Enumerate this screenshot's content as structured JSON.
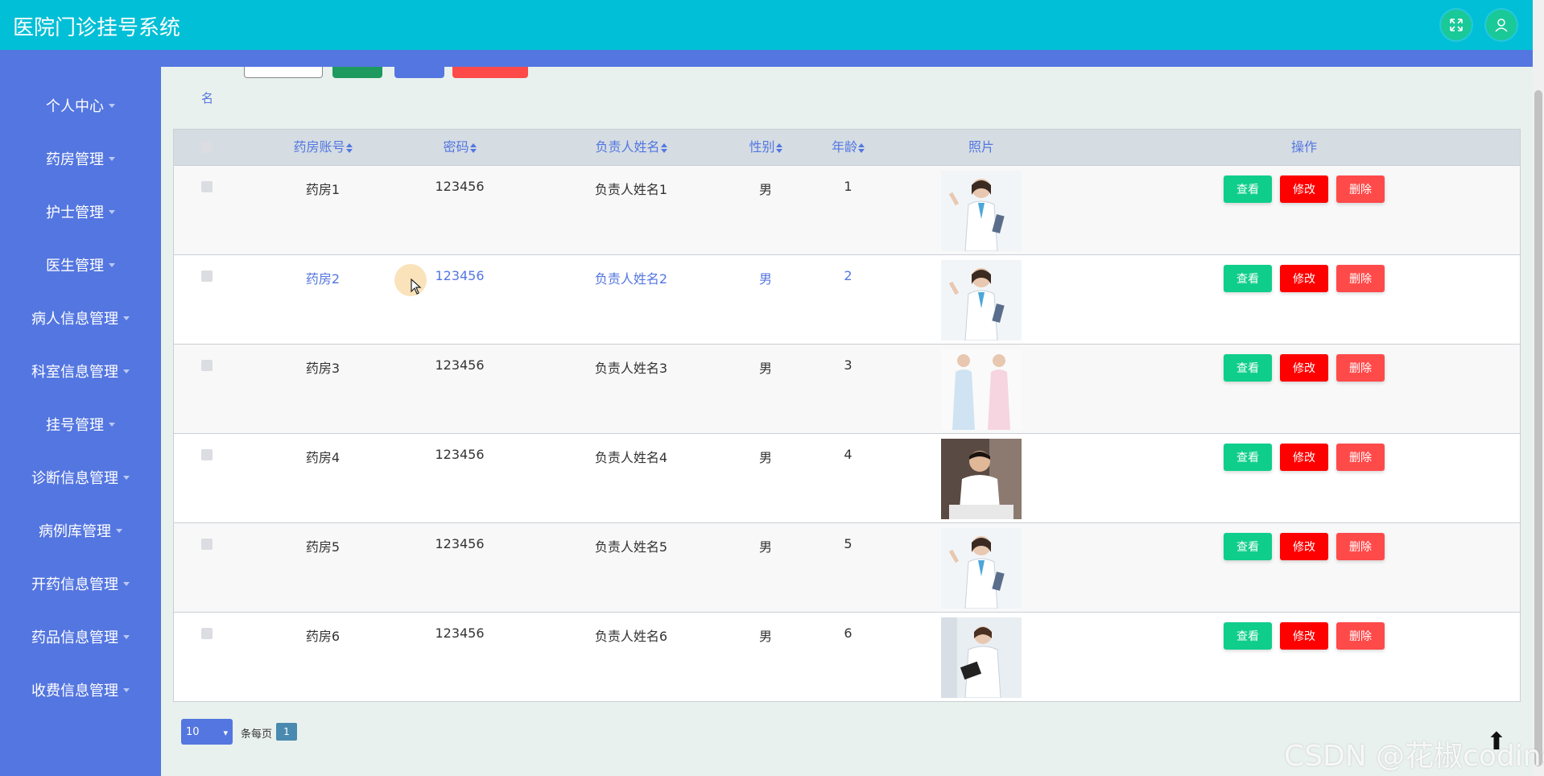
{
  "header": {
    "title": "医院门诊挂号系统",
    "fullscreen_icon": "fullscreen-icon",
    "user_icon": "user-icon"
  },
  "sidebar": {
    "items": [
      {
        "label": "个人中心"
      },
      {
        "label": "药房管理"
      },
      {
        "label": "护士管理"
      },
      {
        "label": "医生管理"
      },
      {
        "label": "病人信息管理"
      },
      {
        "label": "科室信息管理"
      },
      {
        "label": "挂号管理"
      },
      {
        "label": "诊断信息管理"
      },
      {
        "label": "病例库管理"
      },
      {
        "label": "开药信息管理"
      },
      {
        "label": "药品信息管理"
      },
      {
        "label": "收费信息管理"
      }
    ]
  },
  "search": {
    "label_fragment": "名"
  },
  "table": {
    "headers": {
      "account": "药房账号",
      "password": "密码",
      "manager": "负责人姓名",
      "gender": "性别",
      "age": "年龄",
      "photo": "照片",
      "ops": "操作"
    },
    "rows": [
      {
        "account": "药房1",
        "password": "123456",
        "manager": "负责人姓名1",
        "gender": "男",
        "age": "1",
        "photo": "doctor-female-clipboard"
      },
      {
        "account": "药房2",
        "password": "123456",
        "manager": "负责人姓名2",
        "gender": "男",
        "age": "2",
        "photo": "doctor-female-clipboard"
      },
      {
        "account": "药房3",
        "password": "123456",
        "manager": "负责人姓名3",
        "gender": "男",
        "age": "3",
        "photo": "two-nurses"
      },
      {
        "account": "药房4",
        "password": "123456",
        "manager": "负责人姓名4",
        "gender": "男",
        "age": "4",
        "photo": "doctor-male-desk"
      },
      {
        "account": "药房5",
        "password": "123456",
        "manager": "负责人姓名5",
        "gender": "男",
        "age": "5",
        "photo": "doctor-female-clipboard"
      },
      {
        "account": "药房6",
        "password": "123456",
        "manager": "负责人姓名6",
        "gender": "男",
        "age": "6",
        "photo": "doctor-female-tablet"
      }
    ],
    "actions": {
      "view": "查看",
      "edit": "修改",
      "delete": "删除"
    }
  },
  "pager": {
    "page_size": "10",
    "per_page_label": "条每页",
    "current_page": "1"
  },
  "watermark": "CSDN @花椒coding",
  "colors": {
    "header": "#00bfd6",
    "sidebar": "#5476e0",
    "view": "#0fce8c",
    "edit": "#ff0000",
    "delete": "#ff4a4a"
  }
}
